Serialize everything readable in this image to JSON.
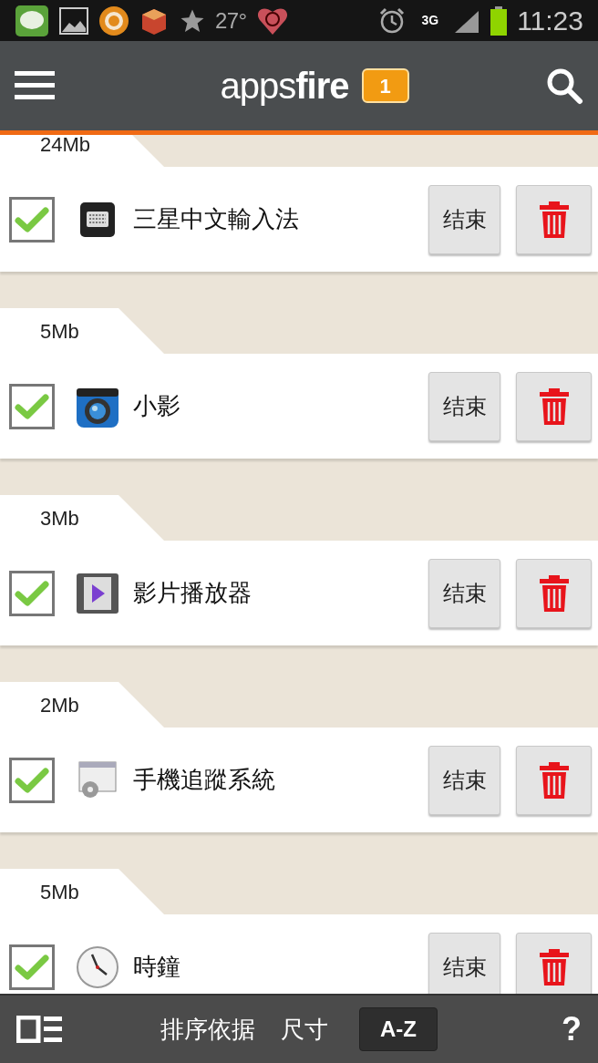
{
  "status_bar": {
    "temperature": "27°",
    "network": "3G",
    "time": "11:23"
  },
  "header": {
    "logo": "apps**fire**",
    "badge": "1"
  },
  "sections": [
    {
      "size": "24Mb",
      "app": {
        "name": "三星中文輸入法",
        "checked": true,
        "end_label": "结束"
      }
    },
    {
      "size": "5Mb",
      "app": {
        "name": "小影",
        "checked": true,
        "end_label": "结束"
      }
    },
    {
      "size": "3Mb",
      "app": {
        "name": "影片播放器",
        "checked": true,
        "end_label": "结束"
      }
    },
    {
      "size": "2Mb",
      "app": {
        "name": "手機追蹤系統",
        "checked": true,
        "end_label": "结束"
      }
    },
    {
      "size": "5Mb",
      "app": {
        "name": "時鐘",
        "checked": true,
        "end_label": "结束"
      }
    }
  ],
  "bottom_bar": {
    "sort_label": "排序依据",
    "sort_options": [
      {
        "label": "尺寸",
        "selected": false
      },
      {
        "label": "A-Z",
        "selected": true
      }
    ],
    "help": "?"
  }
}
